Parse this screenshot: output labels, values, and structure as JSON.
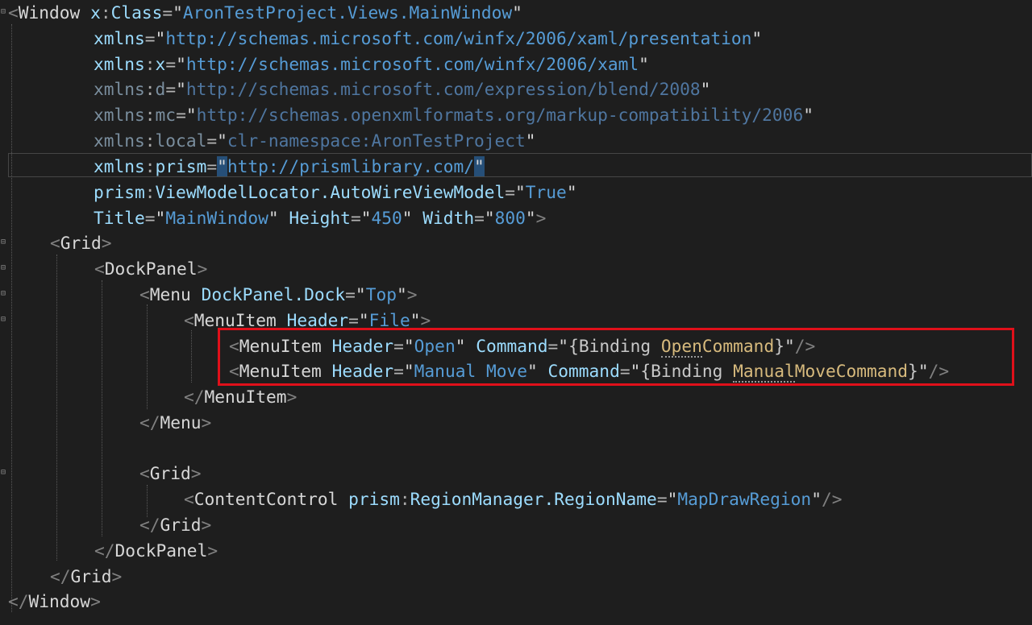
{
  "editor": {
    "language": "XAML",
    "colors": {
      "background": "#1e1e1e",
      "tag": "#d7d7d7",
      "attribute": "#9cdcfe",
      "string_value": "#569cd6",
      "binding_path": "#d7ba7d",
      "highlight_box": "#e0101a",
      "selection": "#264f78"
    },
    "lines": [
      {
        "text": "<Window x:Class=\"AronTestProject.Views.MainWindow\""
      },
      {
        "text": "xmlns=\"http://schemas.microsoft.com/winfx/2006/xaml/presentation\""
      },
      {
        "text": "xmlns:x=\"http://schemas.microsoft.com/winfx/2006/xaml\""
      },
      {
        "text": "xmlns:d=\"http://schemas.microsoft.com/expression/blend/2008\""
      },
      {
        "text": "xmlns:mc=\"http://schemas.openxmlformats.org/markup-compatibility/2006\""
      },
      {
        "text": "xmlns:local=\"clr-namespace:AronTestProject\""
      },
      {
        "text": "xmlns:prism=\"http://prismlibrary.com/\""
      },
      {
        "text": "prism:ViewModelLocator.AutoWireViewModel=\"True\""
      },
      {
        "text": "Title=\"MainWindow\" Height=\"450\" Width=\"800\">"
      },
      {
        "text": "<Grid>"
      },
      {
        "text": "<DockPanel>"
      },
      {
        "text": "<Menu DockPanel.Dock=\"Top\">"
      },
      {
        "text": "<MenuItem Header=\"File\">"
      },
      {
        "text": "<MenuItem Header=\"Open\" Command=\"{Binding OpenCommand}\"/>"
      },
      {
        "text": "<MenuItem Header=\"Manual Move\" Command=\"{Binding ManualMoveCommand}\"/>"
      },
      {
        "text": "</MenuItem>"
      },
      {
        "text": "</Menu>"
      },
      {
        "text": ""
      },
      {
        "text": "<Grid>"
      },
      {
        "text": "<ContentControl prism:RegionManager.RegionName=\"MapDrawRegion\"/>"
      },
      {
        "text": "</Grid>"
      },
      {
        "text": "</DockPanel>"
      },
      {
        "text": "</Grid>"
      },
      {
        "text": "</Window>"
      }
    ]
  }
}
